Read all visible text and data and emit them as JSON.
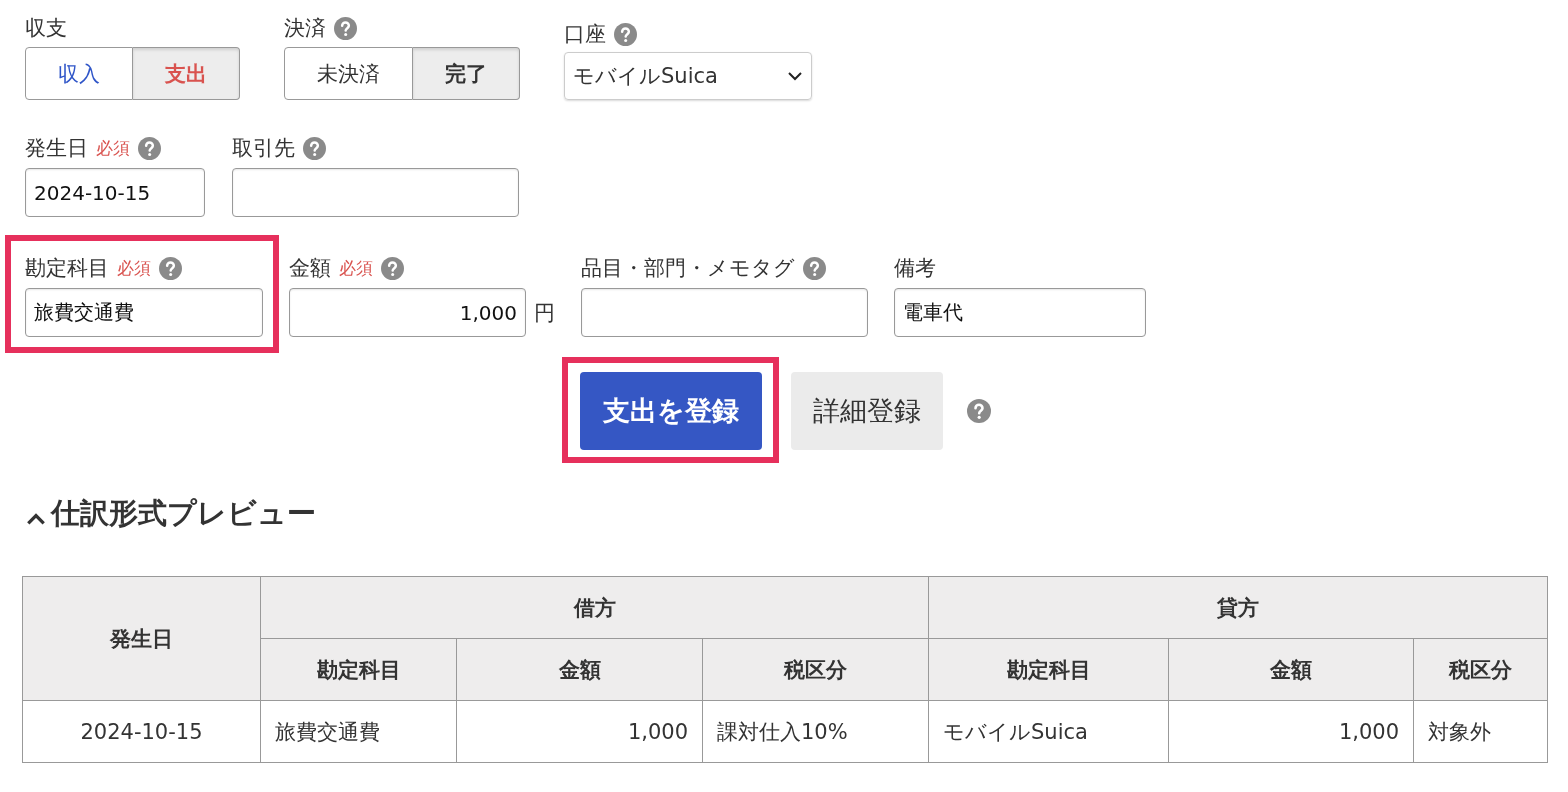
{
  "segments": [
    {
      "label": "収支",
      "help": false,
      "options": [
        {
          "text": "収入",
          "selected": false,
          "color": "#2f55c8"
        },
        {
          "text": "支出",
          "selected": true,
          "color": "#d9534f"
        }
      ]
    },
    {
      "label": "決済",
      "help": true,
      "options": [
        {
          "text": "未決済",
          "selected": false,
          "color": "#333333"
        },
        {
          "text": "完了",
          "selected": true,
          "color": "#333333"
        }
      ]
    }
  ],
  "account_select": {
    "label": "口座",
    "help": true,
    "value": "モバイルSuica"
  },
  "field_rows": [
    [
      {
        "label": "発生日",
        "required": "必須",
        "help": true,
        "value": "2024-10-15",
        "kind": "date",
        "highlighted": false
      },
      {
        "label": "取引先",
        "help": true,
        "kind": "wide",
        "highlighted": false
      }
    ],
    [
      {
        "label": "勘定科目",
        "required": "必須",
        "help": true,
        "value": "旅費交通費",
        "kind": "account",
        "highlighted": true
      },
      {
        "label": "金額",
        "required": "必須",
        "help": true,
        "value": "1,000",
        "unit": "円",
        "kind": "amount",
        "highlighted": false
      },
      {
        "label": "品目・部門・メモタグ",
        "help": true,
        "kind": "wide",
        "highlighted": false
      },
      {
        "label": "備考",
        "help": false,
        "value": "電車代",
        "kind": "memo",
        "highlighted": false
      }
    ]
  ],
  "actions": {
    "primary": {
      "text": "支出を登録",
      "highlighted": true
    },
    "secondary": "詳細登録",
    "help": true
  },
  "preview": {
    "title": "仕訳形式プレビュー",
    "expanded": true,
    "table": {
      "date_header": "発生日",
      "groups": [
        {
          "title": "借方",
          "columns": [
            {
              "label": "勘定科目",
              "kind": "text"
            },
            {
              "label": "金額",
              "kind": "amount"
            },
            {
              "label": "税区分",
              "kind": "text"
            }
          ]
        },
        {
          "title": "貸方",
          "columns": [
            {
              "label": "勘定科目",
              "kind": "text"
            },
            {
              "label": "金額",
              "kind": "amount"
            },
            {
              "label": "税区分",
              "kind": "text"
            }
          ]
        }
      ],
      "rows": [
        {
          "date": "2024-10-15",
          "cells": [
            "旅費交通費",
            "1,000",
            "課対仕入10%",
            "モバイルSuica",
            "1,000",
            "対象外"
          ]
        }
      ]
    }
  }
}
